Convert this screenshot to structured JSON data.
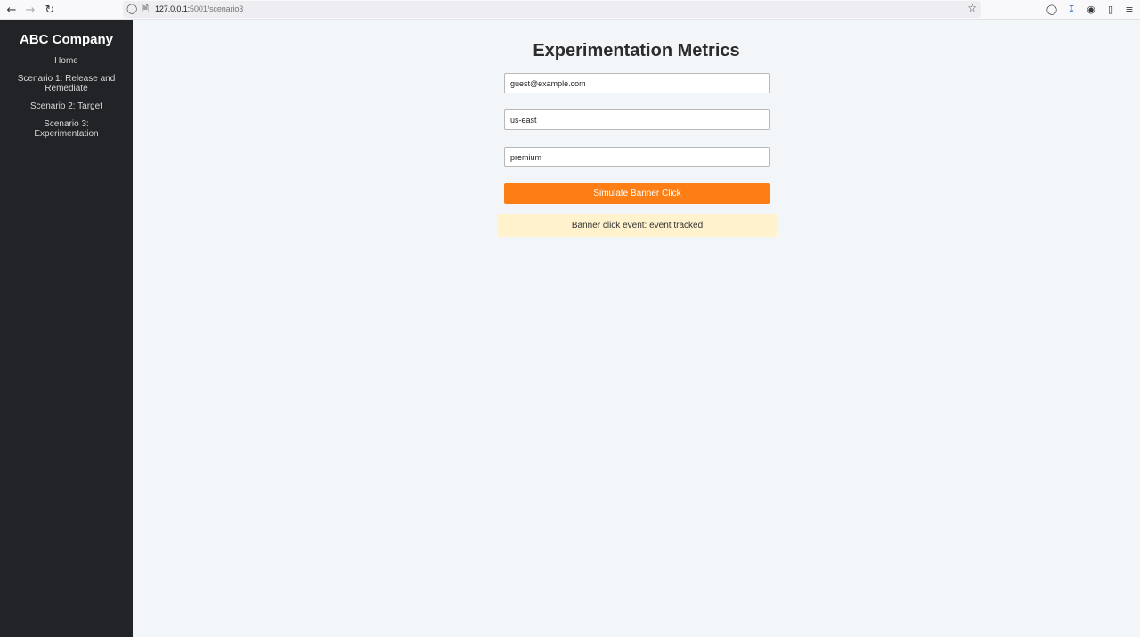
{
  "browser": {
    "url_host": "127.0.0.1:",
    "url_rest": "5001/scenario3",
    "icons": {
      "back": "back-arrow-icon",
      "forward": "forward-arrow-icon",
      "reload": "reload-icon",
      "shield": "shield-icon",
      "page": "page-icon",
      "bookmark": "star-icon",
      "pocket": "pocket-icon",
      "downloads": "download-icon",
      "account": "account-icon",
      "extensions": "extensions-icon",
      "menu": "menu-icon"
    }
  },
  "sidebar": {
    "brand": "ABC Company",
    "items": [
      {
        "label": "Home"
      },
      {
        "label": "Scenario 1: Release and Remediate"
      },
      {
        "label": "Scenario 2: Target"
      },
      {
        "label": "Scenario 3: Experimentation"
      }
    ]
  },
  "main": {
    "title": "Experimentation Metrics",
    "email_value": "guest@example.com",
    "region_value": "us-east",
    "plan_value": "premium",
    "button_label": "Simulate Banner Click",
    "result_text": "Banner click event: event tracked"
  },
  "colors": {
    "sidebar_bg": "#212326",
    "page_bg": "#f3f6f9",
    "button": "#fd7e14",
    "result_bg": "#fff2cc"
  }
}
